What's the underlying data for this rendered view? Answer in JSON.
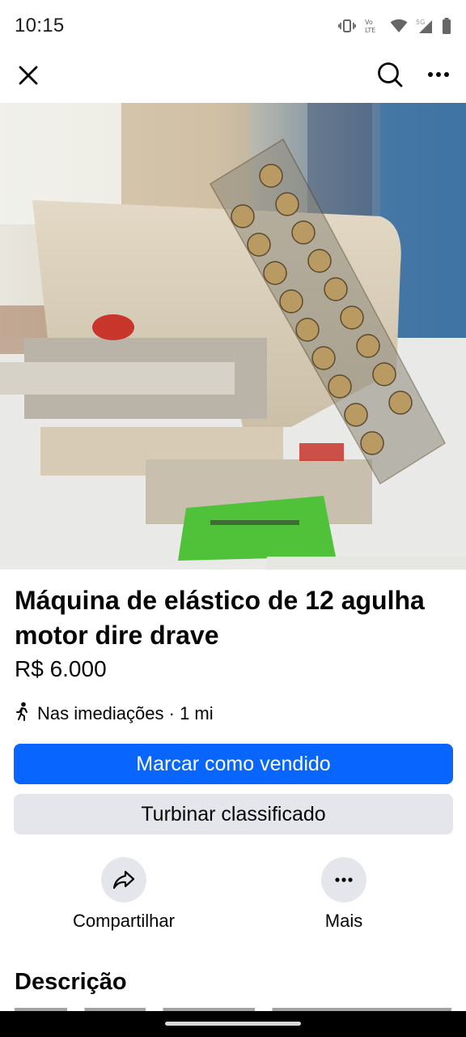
{
  "status_bar": {
    "time": "10:15",
    "icons": [
      "vibrate-icon",
      "volte-icon",
      "wifi-icon",
      "signal-5g-icon",
      "battery-icon"
    ],
    "volte_label": "Vo LTE",
    "network_label": "5G"
  },
  "top_bar": {
    "close_icon": "close-icon",
    "search_icon": "search-icon",
    "more_icon": "more-horizontal-icon"
  },
  "photo": {
    "pager": {
      "count": 3,
      "active_index": 1
    }
  },
  "listing": {
    "title": "Máquina de elástico de 12 agulha motor dire drave",
    "price": "R$ 6.000",
    "location_icon": "walking-person-icon",
    "location": "Nas imediações · 1 mi"
  },
  "buttons": {
    "mark_sold": "Marcar como vendido",
    "boost": "Turbinar classificado"
  },
  "actions": {
    "share": {
      "label": "Compartilhar",
      "icon": "share-icon"
    },
    "more": {
      "label": "Mais",
      "icon": "more-horizontal-icon"
    }
  },
  "description": {
    "heading": "Descrição"
  },
  "colors": {
    "primary": "#0866ff",
    "secondary_bg": "#e4e6eb",
    "text": "#050505"
  }
}
